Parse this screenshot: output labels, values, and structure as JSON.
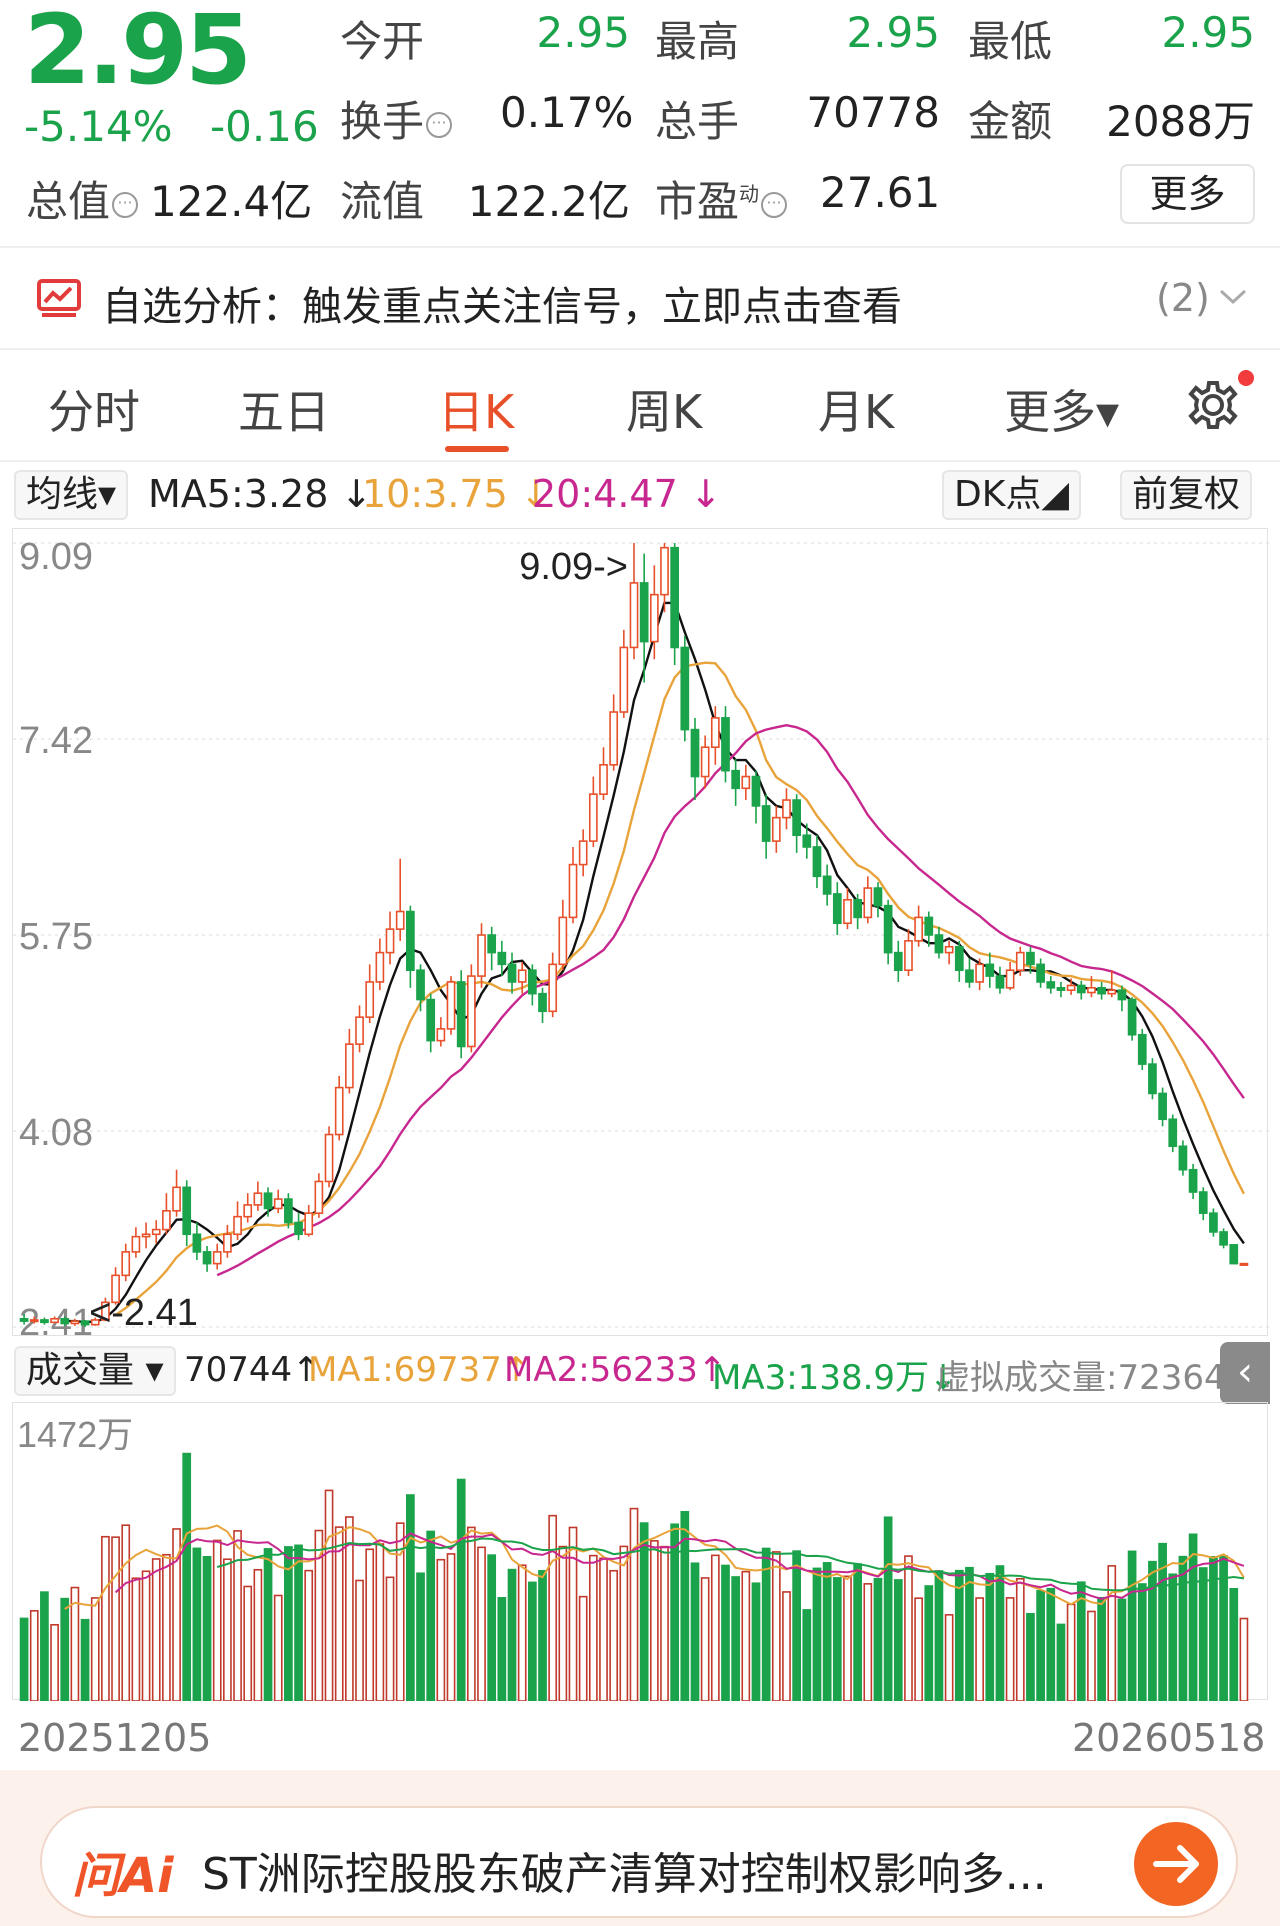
{
  "quote": {
    "price": "2.95",
    "change_pct": "-5.14%",
    "change_abs": "-0.16",
    "open_label": "今开",
    "open_value": "2.95",
    "high_label": "最高",
    "high_value": "2.95",
    "low_label": "最低",
    "low_value": "2.95",
    "turnover_label": "换手",
    "turnover_value": "0.17%",
    "volume_label": "总手",
    "volume_value": "70778",
    "amount_label": "金额",
    "amount_value": "2088万",
    "mktcap_label": "总值",
    "mktcap_value": "122.4亿",
    "float_label": "流值",
    "float_value": "122.2亿",
    "pe_label": "市盈",
    "pe_sup": "动",
    "pe_value": "27.61",
    "more_label": "更多"
  },
  "analysis": {
    "text": "自选分析：触发重点关注信号，立即点击查看",
    "count": "(2)"
  },
  "tabs": {
    "items": [
      "分时",
      "五日",
      "日K",
      "周K",
      "月K",
      "更多▾"
    ],
    "active": "日K"
  },
  "ma_legend": {
    "selector": "均线▾",
    "ma5": "MA5:3.28 ↓",
    "ma10": "10:3.75 ↓",
    "ma20": "20:4.47 ↓",
    "dk_label": "DK点◢",
    "adjust_label": "前复权"
  },
  "volume_legend": {
    "selector": "成交量 ▾",
    "current": "70744↑",
    "ma1": "MA1:69737↑",
    "ma2": "MA2:56233↑",
    "ma3": "MA3:138.9万↓",
    "virtual": "虚拟成交量:72364",
    "collapse": "‹"
  },
  "dates": {
    "start": "20251205",
    "end": "20260518"
  },
  "ai": {
    "logo": "问Ai",
    "text": "ST洲际控股股东破产清算对控制权影响多..."
  },
  "colors": {
    "up": "#e8502a",
    "down": "#1aa34a",
    "ma5": "#111111",
    "ma10": "#e8a33a",
    "ma20": "#c7278e",
    "tag_orange": "#f07a4a",
    "nine_green": "#2fae6b",
    "nine_red": "#e8461e"
  },
  "chart_data": {
    "type": "candlestick",
    "y_axis_ticks": [
      "9.09",
      "7.42",
      "5.75",
      "4.08",
      "2.41"
    ],
    "ylim": [
      2.41,
      9.09
    ],
    "max_label": "9.09->",
    "min_label": "<-2.41",
    "bars": [
      [
        2.48,
        2.46,
        2.52,
        2.43
      ],
      [
        2.46,
        2.47,
        2.5,
        2.44
      ],
      [
        2.47,
        2.45,
        2.49,
        2.43
      ],
      [
        2.45,
        2.48,
        2.5,
        2.44
      ],
      [
        2.48,
        2.44,
        2.5,
        2.42
      ],
      [
        2.44,
        2.46,
        2.48,
        2.42
      ],
      [
        2.46,
        2.43,
        2.47,
        2.41
      ],
      [
        2.43,
        2.47,
        2.49,
        2.42
      ],
      [
        2.47,
        2.62,
        2.66,
        2.46
      ],
      [
        2.62,
        2.85,
        2.92,
        2.6
      ],
      [
        2.85,
        3.05,
        3.12,
        2.8
      ],
      [
        3.05,
        3.18,
        3.26,
        3.0
      ],
      [
        3.18,
        3.2,
        3.3,
        3.08
      ],
      [
        3.2,
        3.24,
        3.32,
        3.12
      ],
      [
        3.24,
        3.4,
        3.55,
        3.2
      ],
      [
        3.4,
        3.6,
        3.75,
        3.35
      ],
      [
        3.6,
        3.2,
        3.66,
        3.1
      ],
      [
        3.2,
        3.05,
        3.3,
        2.98
      ],
      [
        3.05,
        2.95,
        3.1,
        2.88
      ],
      [
        2.95,
        3.05,
        3.12,
        2.9
      ],
      [
        3.05,
        3.2,
        3.28,
        3.0
      ],
      [
        3.2,
        3.35,
        3.48,
        3.15
      ],
      [
        3.35,
        3.45,
        3.55,
        3.3
      ],
      [
        3.45,
        3.55,
        3.65,
        3.4
      ],
      [
        3.55,
        3.42,
        3.6,
        3.35
      ],
      [
        3.42,
        3.5,
        3.58,
        3.38
      ],
      [
        3.5,
        3.3,
        3.55,
        3.25
      ],
      [
        3.3,
        3.2,
        3.38,
        3.15
      ],
      [
        3.2,
        3.38,
        3.45,
        3.18
      ],
      [
        3.38,
        3.65,
        3.72,
        3.34
      ],
      [
        3.65,
        4.05,
        4.12,
        3.6
      ],
      [
        4.05,
        4.45,
        4.55,
        4.0
      ],
      [
        4.45,
        4.82,
        4.95,
        4.4
      ],
      [
        4.82,
        5.05,
        5.15,
        4.75
      ],
      [
        5.05,
        5.35,
        5.5,
        5.0
      ],
      [
        5.35,
        5.6,
        5.72,
        5.28
      ],
      [
        5.6,
        5.8,
        5.95,
        5.5
      ],
      [
        5.8,
        5.95,
        6.4,
        5.7
      ],
      [
        5.95,
        5.45,
        6.0,
        5.3
      ],
      [
        5.45,
        5.2,
        5.5,
        5.1
      ],
      [
        5.2,
        4.85,
        5.25,
        4.75
      ],
      [
        4.85,
        4.95,
        5.05,
        4.8
      ],
      [
        4.95,
        5.35,
        5.4,
        4.9
      ],
      [
        5.35,
        4.8,
        5.45,
        4.7
      ],
      [
        4.8,
        5.4,
        5.5,
        4.75
      ],
      [
        5.4,
        5.75,
        5.85,
        5.3
      ],
      [
        5.75,
        5.6,
        5.82,
        5.45
      ],
      [
        5.6,
        5.5,
        5.7,
        5.4
      ],
      [
        5.5,
        5.35,
        5.6,
        5.25
      ],
      [
        5.35,
        5.45,
        5.52,
        5.25
      ],
      [
        5.45,
        5.25,
        5.5,
        5.15
      ],
      [
        5.25,
        5.1,
        5.3,
        5.0
      ],
      [
        5.1,
        5.5,
        5.6,
        5.05
      ],
      [
        5.5,
        5.9,
        6.05,
        5.45
      ],
      [
        5.9,
        6.35,
        6.5,
        5.85
      ],
      [
        6.35,
        6.55,
        6.65,
        6.25
      ],
      [
        6.55,
        6.95,
        7.1,
        6.5
      ],
      [
        6.95,
        7.2,
        7.35,
        6.9
      ],
      [
        7.2,
        7.65,
        7.8,
        7.15
      ],
      [
        7.65,
        8.2,
        8.35,
        7.6
      ],
      [
        8.2,
        8.75,
        9.09,
        8.1
      ],
      [
        8.75,
        8.25,
        9.0,
        7.9
      ],
      [
        8.25,
        8.65,
        8.9,
        8.1
      ],
      [
        8.65,
        9.05,
        9.09,
        8.5
      ],
      [
        9.05,
        8.2,
        9.09,
        8.05
      ],
      [
        8.2,
        7.5,
        8.3,
        7.4
      ],
      [
        7.5,
        7.1,
        7.6,
        6.9
      ],
      [
        7.1,
        7.35,
        7.45,
        7.0
      ],
      [
        7.35,
        7.6,
        7.7,
        7.2
      ],
      [
        7.6,
        7.15,
        7.7,
        7.05
      ],
      [
        7.15,
        7.0,
        7.25,
        6.85
      ],
      [
        7.0,
        7.1,
        7.2,
        6.9
      ],
      [
        7.1,
        6.85,
        7.15,
        6.7
      ],
      [
        6.85,
        6.55,
        6.95,
        6.4
      ],
      [
        6.55,
        6.75,
        6.85,
        6.45
      ],
      [
        6.75,
        6.9,
        7.0,
        6.65
      ],
      [
        6.9,
        6.6,
        6.95,
        6.45
      ],
      [
        6.6,
        6.5,
        6.7,
        6.4
      ],
      [
        6.5,
        6.25,
        6.6,
        6.15
      ],
      [
        6.25,
        6.1,
        6.35,
        6.0
      ],
      [
        6.1,
        5.85,
        6.2,
        5.75
      ],
      [
        5.85,
        6.05,
        6.15,
        5.8
      ],
      [
        6.05,
        5.9,
        6.1,
        5.8
      ],
      [
        5.9,
        6.15,
        6.25,
        5.85
      ],
      [
        6.15,
        6.0,
        6.2,
        5.9
      ],
      [
        6.0,
        5.6,
        6.05,
        5.5
      ],
      [
        5.6,
        5.45,
        5.7,
        5.35
      ],
      [
        5.45,
        5.7,
        5.8,
        5.4
      ],
      [
        5.7,
        5.9,
        6.0,
        5.65
      ],
      [
        5.9,
        5.75,
        5.95,
        5.65
      ],
      [
        5.75,
        5.6,
        5.82,
        5.55
      ],
      [
        5.6,
        5.65,
        5.7,
        5.5
      ],
      [
        5.65,
        5.45,
        5.7,
        5.35
      ],
      [
        5.45,
        5.35,
        5.55,
        5.3
      ],
      [
        5.35,
        5.5,
        5.55,
        5.28
      ],
      [
        5.5,
        5.4,
        5.6,
        5.3
      ],
      [
        5.4,
        5.3,
        5.48,
        5.25
      ],
      [
        5.3,
        5.45,
        5.52,
        5.28
      ],
      [
        5.45,
        5.6,
        5.65,
        5.4
      ],
      [
        5.6,
        5.5,
        5.65,
        5.42
      ],
      [
        5.5,
        5.35,
        5.55,
        5.3
      ],
      [
        5.35,
        5.3,
        5.4,
        5.25
      ],
      [
        5.3,
        5.28,
        5.35,
        5.22
      ],
      [
        5.28,
        5.32,
        5.38,
        5.24
      ],
      [
        5.32,
        5.26,
        5.36,
        5.2
      ],
      [
        5.26,
        5.3,
        5.4,
        5.22
      ],
      [
        5.3,
        5.25,
        5.35,
        5.2
      ],
      [
        5.25,
        5.28,
        5.45,
        5.22
      ],
      [
        5.28,
        5.2,
        5.32,
        5.1
      ],
      [
        5.2,
        4.9,
        5.22,
        4.85
      ],
      [
        4.9,
        4.65,
        4.95,
        4.6
      ],
      [
        4.65,
        4.4,
        4.7,
        4.35
      ],
      [
        4.4,
        4.18,
        4.45,
        4.12
      ],
      [
        4.18,
        3.95,
        4.22,
        3.9
      ],
      [
        3.95,
        3.75,
        4.0,
        3.7
      ],
      [
        3.75,
        3.56,
        3.8,
        3.5
      ],
      [
        3.56,
        3.38,
        3.6,
        3.32
      ],
      [
        3.38,
        3.22,
        3.42,
        3.18
      ],
      [
        3.22,
        3.11,
        3.25,
        3.08
      ],
      [
        3.11,
        2.95,
        3.11,
        2.95
      ],
      [
        2.95,
        2.95,
        2.95,
        2.95
      ]
    ],
    "volume_max_label": "1472万"
  }
}
